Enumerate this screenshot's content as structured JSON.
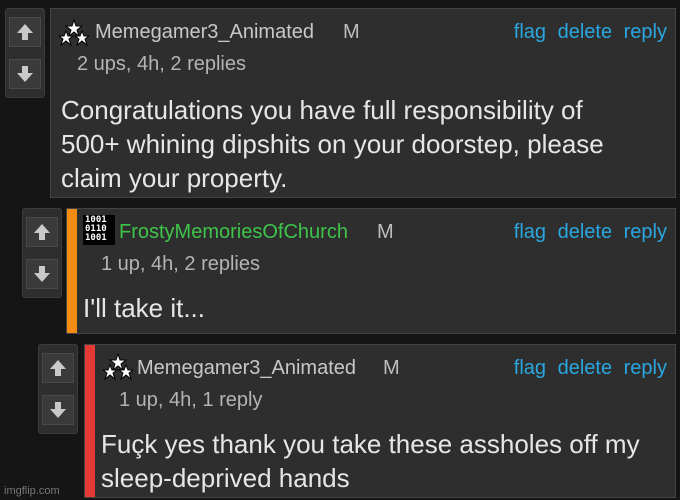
{
  "comments": [
    {
      "username": "Memegamer3_Animated",
      "badge": "M",
      "meta": "2 ups, 4h, 2 replies",
      "text_lines": [
        "Congratulations you have full responsibility of",
        "500+ whining dipshits on your doorstep, please",
        "claim your property."
      ],
      "actions": {
        "flag": "flag",
        "delete": "delete",
        "reply": "reply"
      },
      "username_color": "#c8c8c8",
      "accent_color": "",
      "avatar_icon": "stars-triangle-icon"
    },
    {
      "username": "FrostyMemoriesOfChurch",
      "badge": "M",
      "meta": "1 up, 4h, 2 replies",
      "text_lines": [
        "I'll take it..."
      ],
      "actions": {
        "flag": "flag",
        "delete": "delete",
        "reply": "reply"
      },
      "username_color": "#3fc44a",
      "accent_color": "#f28c12",
      "avatar_icon": "binary-pattern-icon",
      "avatar_text": [
        "1001",
        "0110",
        "1001"
      ]
    },
    {
      "username": "Memegamer3_Animated",
      "badge": "M",
      "meta": "1 up, 4h, 1 reply",
      "text_lines": [
        "Fuçk yes thank you take these assholes off my",
        "sleep-deprived hands"
      ],
      "actions": {
        "flag": "flag",
        "delete": "delete",
        "reply": "reply"
      },
      "username_color": "#c8c8c8",
      "accent_color": "#e53935",
      "avatar_icon": "stars-triangle-icon"
    }
  ],
  "watermark": "imgflip.com"
}
